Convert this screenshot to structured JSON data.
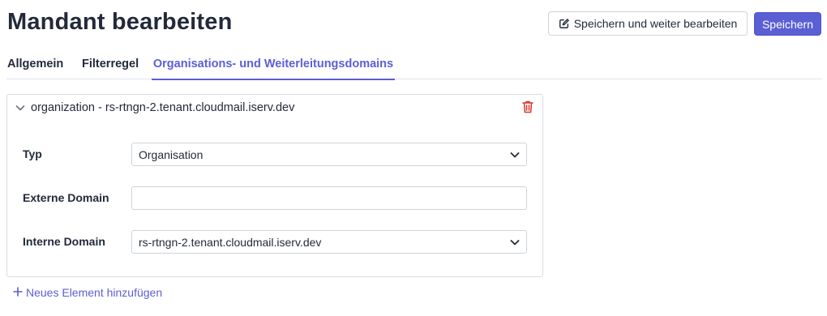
{
  "header": {
    "title": "Mandant bearbeiten",
    "save_continue_label": "Speichern und weiter bearbeiten",
    "save_label": "Speichern"
  },
  "tabs": [
    {
      "label": "Allgemein",
      "active": false
    },
    {
      "label": "Filterregel",
      "active": false
    },
    {
      "label": "Organisations- und Weiterleitungsdomains",
      "active": true
    }
  ],
  "entry": {
    "title": "organization - rs-rtngn-2.tenant.cloudmail.iserv.dev",
    "fields": {
      "type_label": "Typ",
      "type_value": "Organisation",
      "external_label": "Externe Domain",
      "external_value": "",
      "internal_label": "Interne Domain",
      "internal_value": "rs-rtngn-2.tenant.cloudmail.iserv.dev"
    }
  },
  "add_element_label": "Neues Element hinzufügen",
  "colors": {
    "accent": "#5b5fd4",
    "danger": "#d9362b",
    "text": "#222a3a"
  },
  "icons": {
    "edit": "edit-icon",
    "chevron": "chevron-down-icon",
    "trash": "trash-icon",
    "plus": "plus-icon"
  }
}
